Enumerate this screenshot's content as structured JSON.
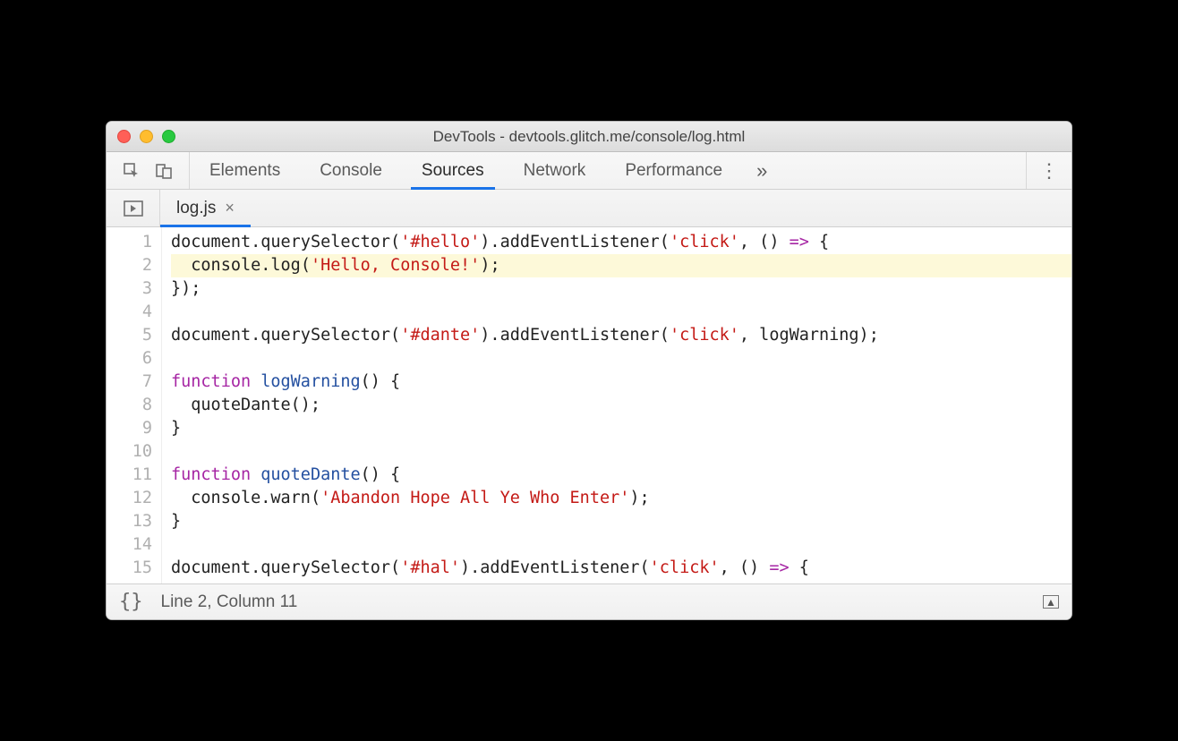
{
  "window": {
    "title": "DevTools - devtools.glitch.me/console/log.html"
  },
  "toolbar": {
    "tabs": [
      "Elements",
      "Console",
      "Sources",
      "Network",
      "Performance"
    ],
    "active_index": 2,
    "more_glyph": "»",
    "menu_glyph": "⋮"
  },
  "file_tab": {
    "name": "log.js",
    "close_glyph": "×"
  },
  "code": {
    "highlight_line": 2,
    "lines": [
      {
        "n": 1,
        "tokens": [
          {
            "t": "document",
            "c": ""
          },
          {
            "t": ".",
            "c": ""
          },
          {
            "t": "querySelector",
            "c": ""
          },
          {
            "t": "(",
            "c": ""
          },
          {
            "t": "'#hello'",
            "c": "s"
          },
          {
            "t": ").",
            "c": ""
          },
          {
            "t": "addEventListener",
            "c": ""
          },
          {
            "t": "(",
            "c": ""
          },
          {
            "t": "'click'",
            "c": "s"
          },
          {
            "t": ", () ",
            "c": ""
          },
          {
            "t": "=>",
            "c": "k"
          },
          {
            "t": " {",
            "c": ""
          }
        ]
      },
      {
        "n": 2,
        "tokens": [
          {
            "t": "  console.",
            "c": ""
          },
          {
            "t": "log",
            "c": ""
          },
          {
            "t": "(",
            "c": ""
          },
          {
            "t": "'Hello, Console!'",
            "c": "s"
          },
          {
            "t": ");",
            "c": ""
          }
        ]
      },
      {
        "n": 3,
        "tokens": [
          {
            "t": "});",
            "c": ""
          }
        ]
      },
      {
        "n": 4,
        "tokens": [
          {
            "t": "",
            "c": ""
          }
        ]
      },
      {
        "n": 5,
        "tokens": [
          {
            "t": "document",
            "c": ""
          },
          {
            "t": ".",
            "c": ""
          },
          {
            "t": "querySelector",
            "c": ""
          },
          {
            "t": "(",
            "c": ""
          },
          {
            "t": "'#dante'",
            "c": "s"
          },
          {
            "t": ").",
            "c": ""
          },
          {
            "t": "addEventListener",
            "c": ""
          },
          {
            "t": "(",
            "c": ""
          },
          {
            "t": "'click'",
            "c": "s"
          },
          {
            "t": ", logWarning);",
            "c": ""
          }
        ]
      },
      {
        "n": 6,
        "tokens": [
          {
            "t": "",
            "c": ""
          }
        ]
      },
      {
        "n": 7,
        "tokens": [
          {
            "t": "function",
            "c": "k"
          },
          {
            "t": " ",
            "c": ""
          },
          {
            "t": "logWarning",
            "c": "fn"
          },
          {
            "t": "() {",
            "c": ""
          }
        ]
      },
      {
        "n": 8,
        "tokens": [
          {
            "t": "  quoteDante();",
            "c": ""
          }
        ]
      },
      {
        "n": 9,
        "tokens": [
          {
            "t": "}",
            "c": ""
          }
        ]
      },
      {
        "n": 10,
        "tokens": [
          {
            "t": "",
            "c": ""
          }
        ]
      },
      {
        "n": 11,
        "tokens": [
          {
            "t": "function",
            "c": "k"
          },
          {
            "t": " ",
            "c": ""
          },
          {
            "t": "quoteDante",
            "c": "fn"
          },
          {
            "t": "() {",
            "c": ""
          }
        ]
      },
      {
        "n": 12,
        "tokens": [
          {
            "t": "  console.",
            "c": ""
          },
          {
            "t": "warn",
            "c": ""
          },
          {
            "t": "(",
            "c": ""
          },
          {
            "t": "'Abandon Hope All Ye Who Enter'",
            "c": "s"
          },
          {
            "t": ");",
            "c": ""
          }
        ]
      },
      {
        "n": 13,
        "tokens": [
          {
            "t": "}",
            "c": ""
          }
        ]
      },
      {
        "n": 14,
        "tokens": [
          {
            "t": "",
            "c": ""
          }
        ]
      },
      {
        "n": 15,
        "tokens": [
          {
            "t": "document",
            "c": ""
          },
          {
            "t": ".",
            "c": ""
          },
          {
            "t": "querySelector",
            "c": ""
          },
          {
            "t": "(",
            "c": ""
          },
          {
            "t": "'#hal'",
            "c": "s"
          },
          {
            "t": ").",
            "c": ""
          },
          {
            "t": "addEventListener",
            "c": ""
          },
          {
            "t": "(",
            "c": ""
          },
          {
            "t": "'click'",
            "c": "s"
          },
          {
            "t": ", () ",
            "c": ""
          },
          {
            "t": "=>",
            "c": "k"
          },
          {
            "t": " {",
            "c": ""
          }
        ]
      }
    ]
  },
  "status": {
    "braces_glyph": "{}",
    "position_text": "Line 2, Column 11"
  }
}
